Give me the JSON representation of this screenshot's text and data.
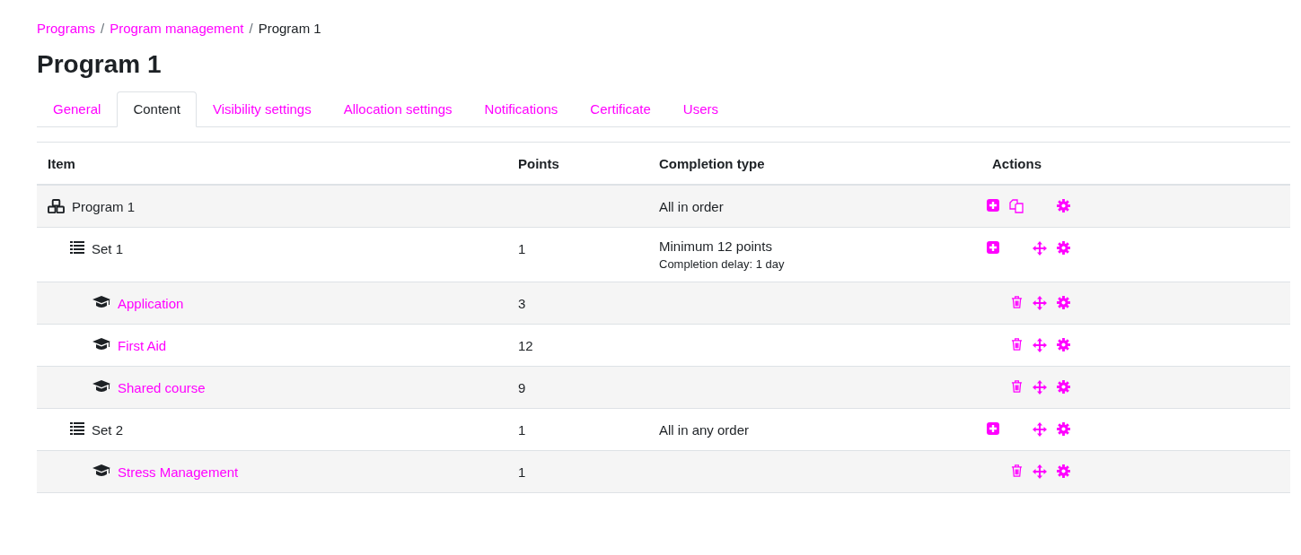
{
  "breadcrumb": [
    {
      "kind": "link",
      "label": "Programs"
    },
    {
      "kind": "separator",
      "label": "/"
    },
    {
      "kind": "link",
      "label": "Program management"
    },
    {
      "kind": "separator",
      "label": "/"
    },
    {
      "kind": "current",
      "label": "Program 1"
    }
  ],
  "title": "Program 1",
  "tabs": [
    {
      "label": "General",
      "selected": false
    },
    {
      "label": "Content",
      "selected": true
    },
    {
      "label": "Visibility settings",
      "selected": false
    },
    {
      "label": "Allocation settings",
      "selected": false
    },
    {
      "label": "Notifications",
      "selected": false
    },
    {
      "label": "Certificate",
      "selected": false
    },
    {
      "label": "Users",
      "selected": false
    }
  ],
  "table": {
    "columns": [
      "Item",
      "Points",
      "Completion type",
      "Actions"
    ],
    "rows": [
      {
        "kind": "program",
        "name": "Program 1",
        "points": "",
        "completion": "All in order",
        "actions": {
          "add": true,
          "copy": true,
          "delete": false,
          "move": false,
          "settings": true
        },
        "children": [
          {
            "kind": "set",
            "name": "Set 1",
            "points": "1",
            "completion": "Minimum 12 points",
            "note": "Completion delay: 1 day",
            "actions": {
              "add": true,
              "copy": false,
              "delete": false,
              "move": true,
              "settings": true
            },
            "children": [
              {
                "kind": "course",
                "name": "Application",
                "points": "3",
                "actions": {
                  "add": false,
                  "copy": false,
                  "delete": true,
                  "move": true,
                  "settings": true
                }
              },
              {
                "kind": "course",
                "name": "First Aid",
                "points": "12",
                "actions": {
                  "add": false,
                  "copy": false,
                  "delete": true,
                  "move": true,
                  "settings": true
                }
              },
              {
                "kind": "course",
                "name": "Shared course",
                "points": "9",
                "actions": {
                  "add": false,
                  "copy": false,
                  "delete": true,
                  "move": true,
                  "settings": true
                }
              }
            ]
          },
          {
            "kind": "set",
            "name": "Set 2",
            "points": "1",
            "completion": "All in any order",
            "actions": {
              "add": true,
              "copy": false,
              "delete": false,
              "move": true,
              "settings": true
            },
            "children": [
              {
                "kind": "course",
                "name": "Stress Management",
                "points": "1",
                "actions": {
                  "add": false,
                  "copy": false,
                  "delete": true,
                  "move": true,
                  "settings": true
                }
              }
            ]
          }
        ]
      }
    ]
  }
}
